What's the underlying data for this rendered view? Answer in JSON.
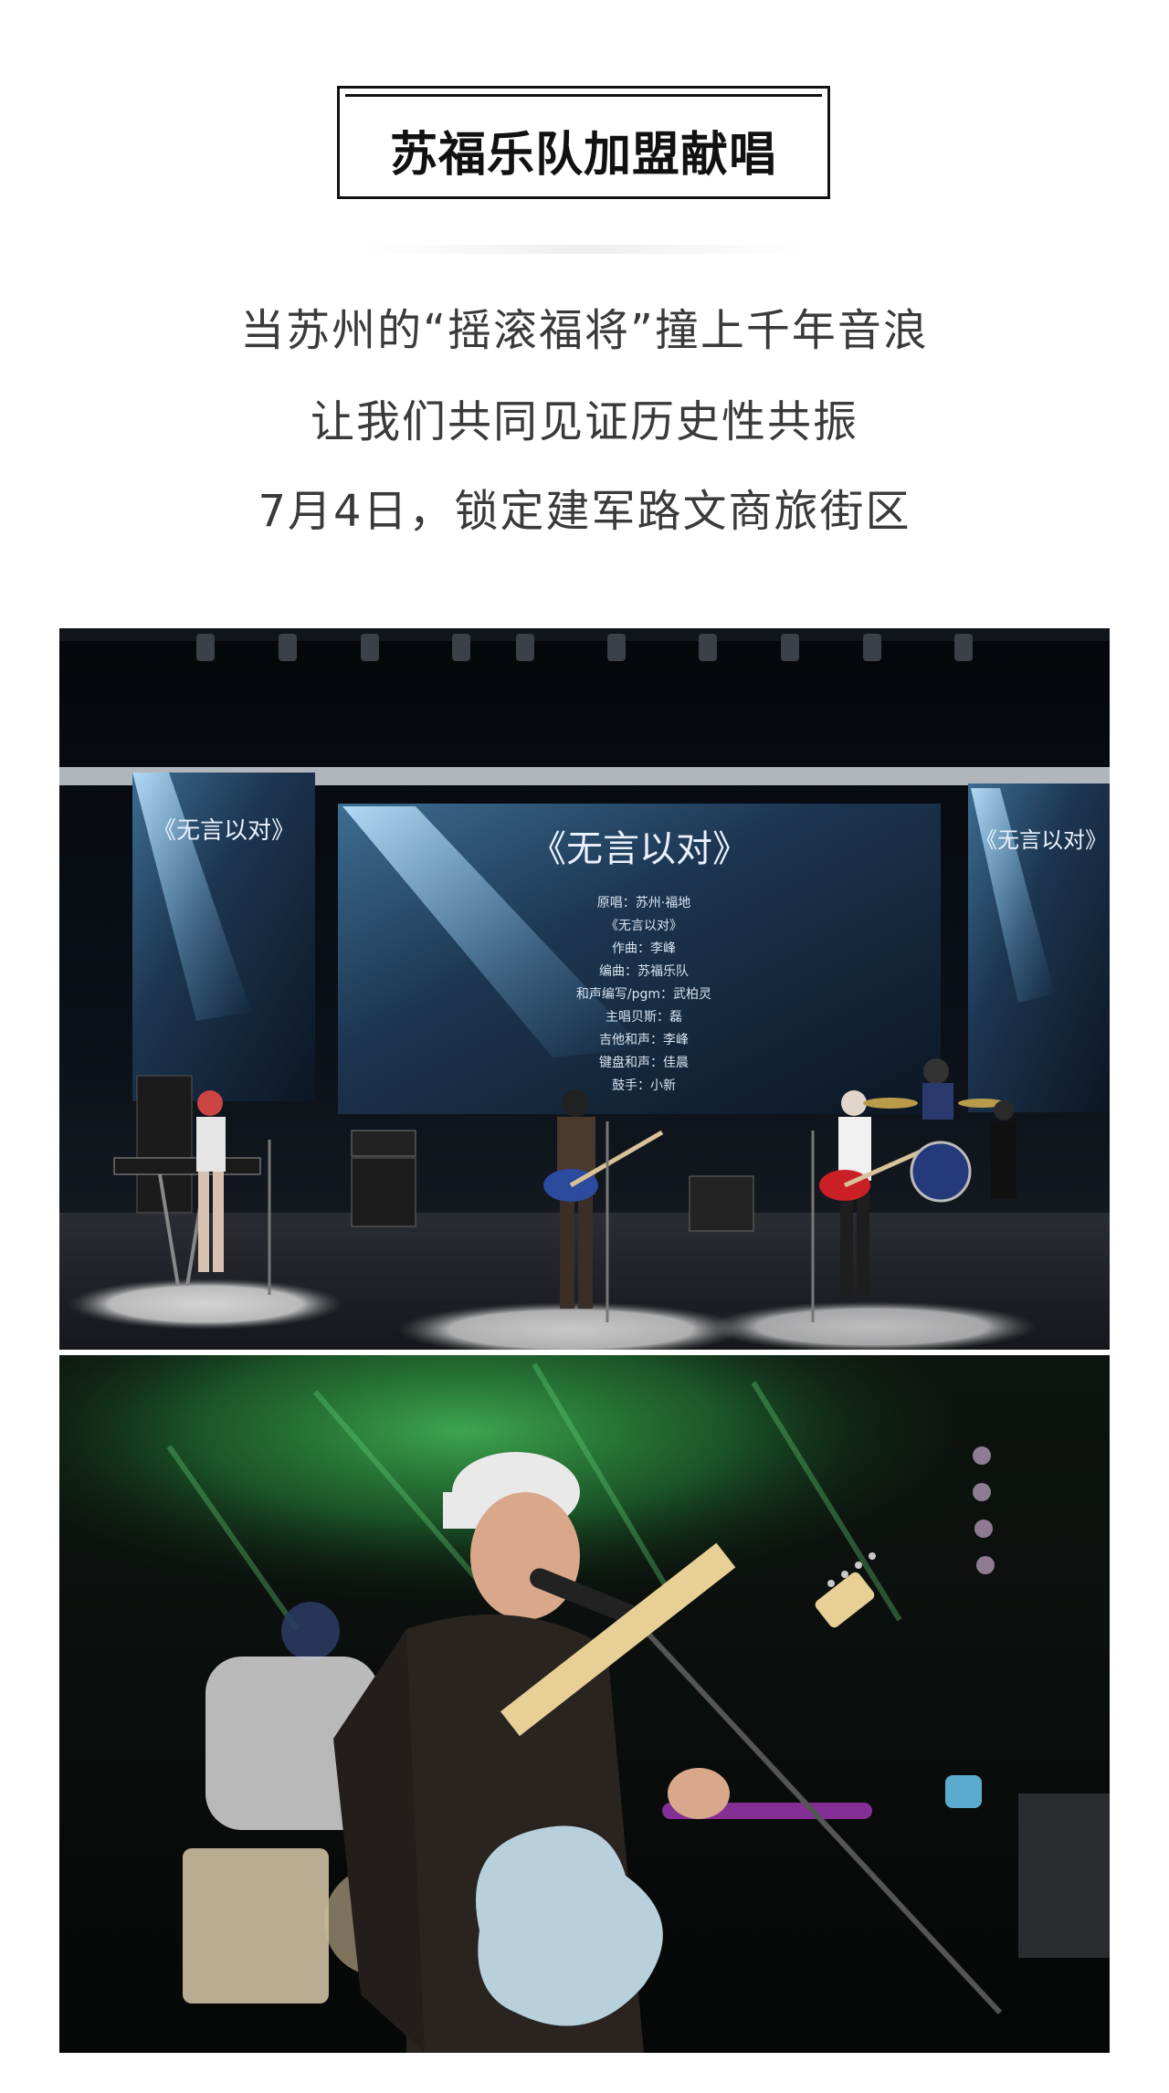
{
  "header": {
    "title": "苏福乐队加盟献唱"
  },
  "intro": {
    "lines": [
      "当苏州的“摇滚福将”撞上千年音浪",
      "让我们共同见证历史性共振",
      "7月4日，锁定建军路文商旅街区"
    ]
  },
  "photo_stage": {
    "screen_title": "《无言以对》",
    "screen_credits": [
      "原唱：苏州·福地",
      "《无言以对》",
      "作曲：李峰",
      "编曲：苏福乐队",
      "和声编写/pgm：武柏灵",
      "主唱贝斯：磊",
      "吉他和声：李峰",
      "键盘和声：佳晨",
      "鼓手：小新"
    ],
    "side_title": "《无言以对》"
  },
  "photo_guitarist": {
    "content": "guitarist-closeup"
  },
  "colors": {
    "title_border": "#111111",
    "text": "#3a3a3a",
    "stage_dark": "#0a0d14",
    "screen_blue": "#1e3550",
    "green_light": "#2c8a3c"
  }
}
